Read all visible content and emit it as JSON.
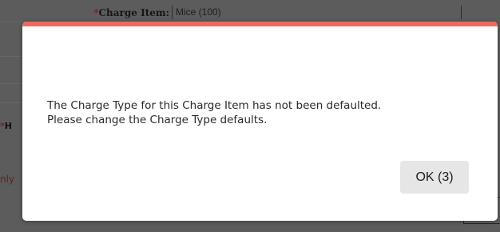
{
  "background_form": {
    "charge_item": {
      "required_marker": "*",
      "label": "Charge Item:",
      "value": "Mice (100)"
    },
    "partial_label_edge": {
      "required_marker": "*",
      "text": "H"
    },
    "partial_text_edge": "nly"
  },
  "dialog": {
    "message_line_1": "The Charge Type for this Charge Item has not been defaulted.",
    "message_line_2": "Please change the Charge Type defaults.",
    "ok_button_label": "OK (3)",
    "countdown_seconds": 3,
    "accent_color": "#f0695f"
  }
}
